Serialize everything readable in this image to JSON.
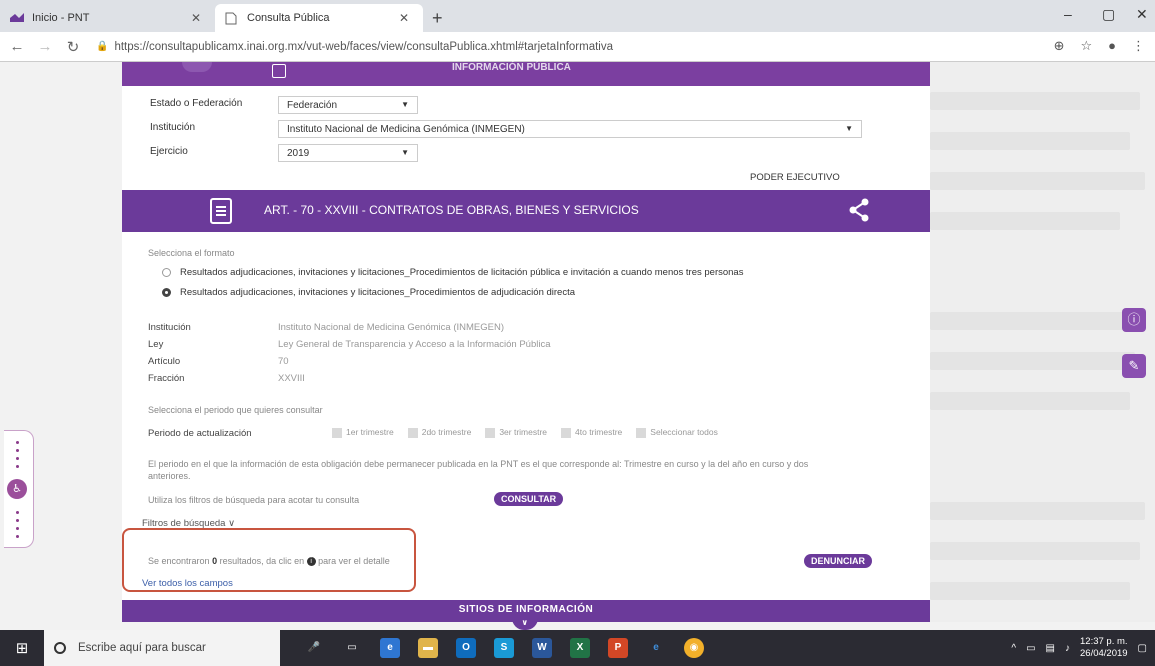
{
  "browser": {
    "tabs": [
      {
        "title": "Inicio - PNT",
        "active": false
      },
      {
        "title": "Consulta Pública",
        "active": true
      }
    ],
    "url": "https://consultapublicamx.inai.org.mx/vut-web/faces/view/consultaPublica.xhtml#tarjetaInformativa",
    "new_tab": "+",
    "window_controls": {
      "minimize": "–",
      "maximize": "▢",
      "close": "✕"
    }
  },
  "header": {
    "title": "INFORMACIÓN PÚBLICA"
  },
  "filters": {
    "estado_label": "Estado o Federación",
    "estado_value": "Federación",
    "institucion_label": "Institución",
    "institucion_value": "Instituto Nacional de Medicina Genómica (INMEGEN)",
    "ejercicio_label": "Ejercicio",
    "ejercicio_value": "2019",
    "poder": "PODER EJECUTIVO"
  },
  "article": {
    "title": "ART. - 70 - XXVIII - CONTRATOS DE OBRAS, BIENES Y SERVICIOS"
  },
  "formato": {
    "label": "Selecciona el formato",
    "options": [
      {
        "text": "Resultados adjudicaciones, invitaciones y licitaciones_Procedimientos de licitación pública e invitación a cuando menos tres personas",
        "selected": false
      },
      {
        "text": "Resultados adjudicaciones, invitaciones y licitaciones_Procedimientos de adjudicación directa",
        "selected": true
      }
    ]
  },
  "details": [
    {
      "key": "Institución",
      "value": "Instituto Nacional de Medicina Genómica (INMEGEN)"
    },
    {
      "key": "Ley",
      "value": "Ley General de Transparencia y Acceso a la Información Pública"
    },
    {
      "key": "Artículo",
      "value": "70"
    },
    {
      "key": "Fracción",
      "value": "XXVIII"
    }
  ],
  "periodo": {
    "prompt": "Selecciona el periodo que quieres consultar",
    "label": "Periodo de actualización",
    "options": [
      {
        "text": "1er trimestre",
        "checked": true
      },
      {
        "text": "2do trimestre",
        "checked": false
      },
      {
        "text": "3er trimestre",
        "checked": false
      },
      {
        "text": "4to trimestre",
        "checked": false
      },
      {
        "text": "Seleccionar todos",
        "checked": false
      }
    ],
    "note": "El periodo en el que la información de esta obligación debe permanecer publicada en la PNT es el que corresponde al: Trimestre en curso y la del año en curso y dos anteriores."
  },
  "consulta": {
    "hint": "Utiliza los filtros de búsqueda para acotar tu consulta",
    "button": "CONSULTAR"
  },
  "results": {
    "filtros_toggle": "Filtros de búsqueda ∨",
    "found_prefix": "Se encontraron",
    "found_count": "0",
    "found_suffix": "resultados, da clic en",
    "found_end": "para ver el detalle",
    "see_all": "Ver todos los campos",
    "report_button": "DENUNCIAR"
  },
  "footer": {
    "sitios": "SITIOS DE INFORMACIÓN"
  },
  "taskbar": {
    "search_placeholder": "Escribe aquí para buscar",
    "time": "12:37 p. m.",
    "date": "26/04/2019"
  },
  "colors": {
    "purple": "#6b3a9a",
    "highlight_box": "#c8553f"
  }
}
